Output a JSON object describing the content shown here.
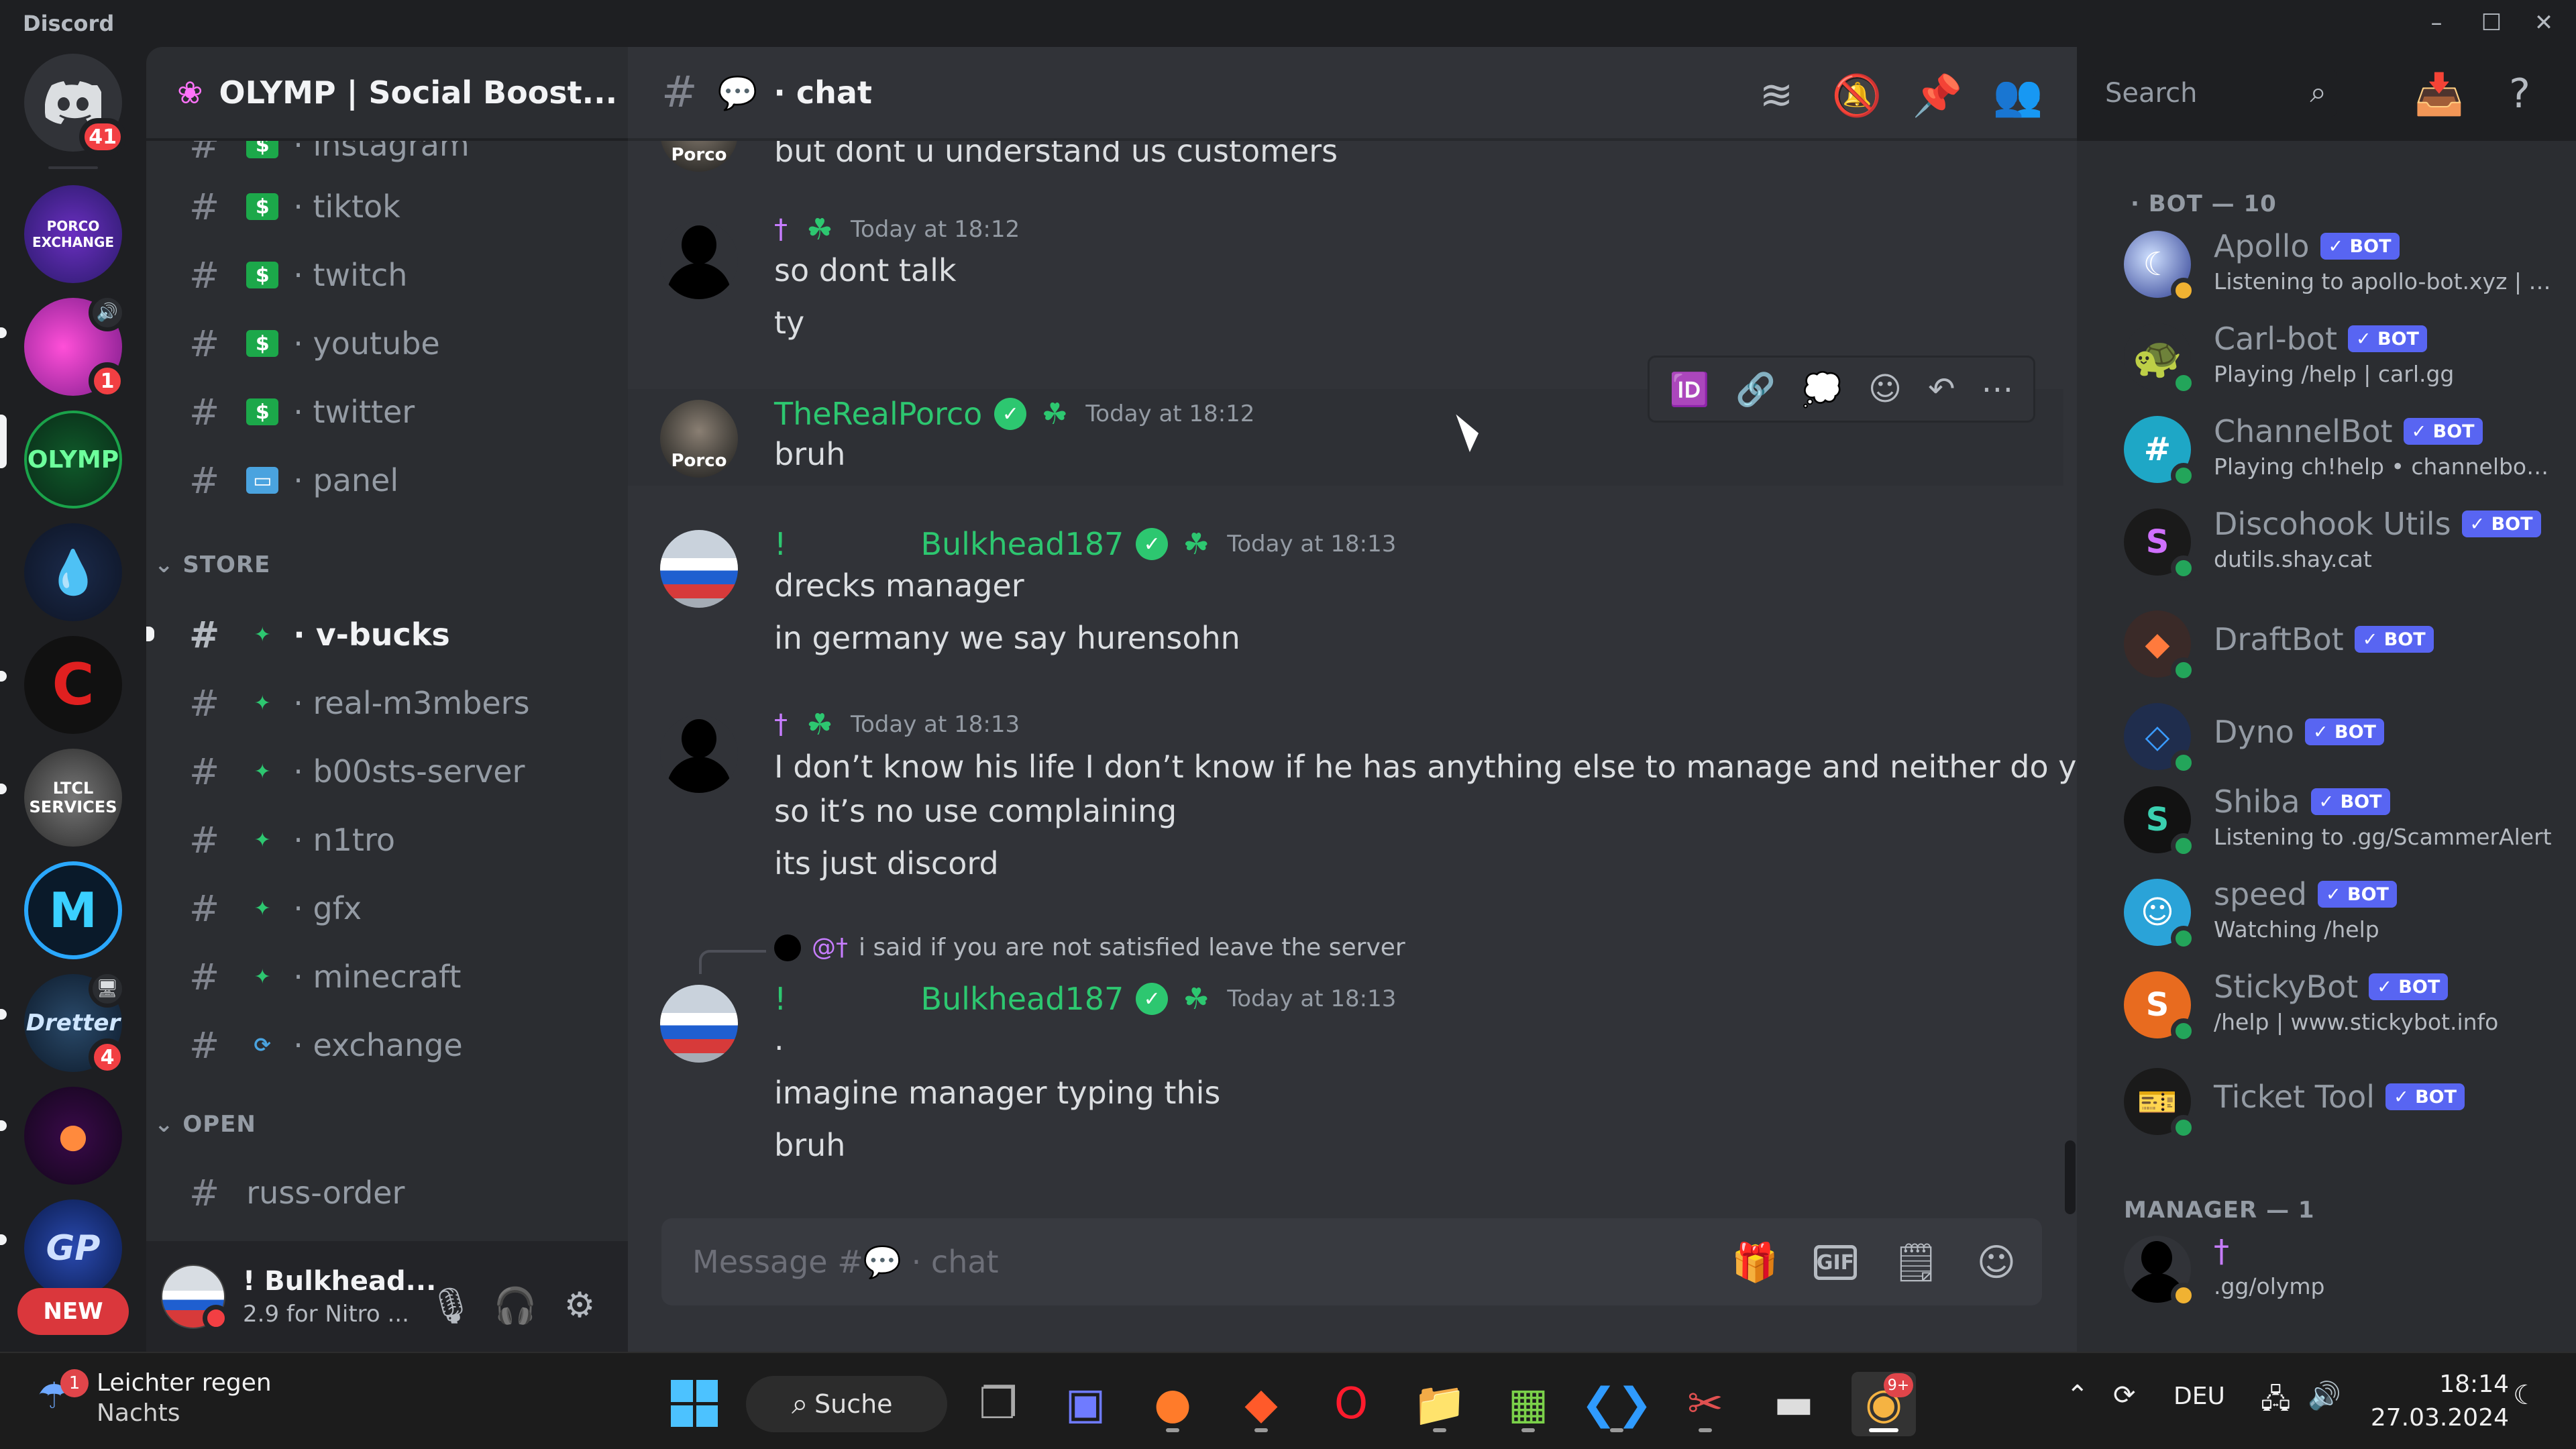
{
  "window": {
    "title": "Discord",
    "controls": [
      "–",
      "☐",
      "✕"
    ]
  },
  "rail": {
    "home_badge": "41",
    "server_badges": {
      "s2": "1",
      "s9": "4"
    },
    "server_labels": {
      "porco": "PORCO EXCHANGE",
      "olymp": "OLYMP",
      "ltcl": "LTCL SERVICES",
      "gp": "GP",
      "dretter": "Dretter"
    },
    "new_label": "NEW"
  },
  "guild": {
    "name": "OLYMP | Social Boost...",
    "channels_top": [
      {
        "name": "instagram",
        "emoji": "money"
      },
      {
        "name": "tiktok",
        "emoji": "money"
      },
      {
        "name": "twitch",
        "emoji": "money"
      },
      {
        "name": "youtube",
        "emoji": "money"
      },
      {
        "name": "twitter",
        "emoji": "money"
      },
      {
        "name": "panel",
        "emoji": "laptop"
      }
    ],
    "category_store": "STORE",
    "channels_store": [
      {
        "name": "v-bucks",
        "active": true
      },
      {
        "name": "real-m3mbers"
      },
      {
        "name": "b00sts-server"
      },
      {
        "name": "n1tro"
      },
      {
        "name": "gfx"
      },
      {
        "name": "minecraft"
      },
      {
        "name": "exchange"
      }
    ],
    "category_open": "OPEN",
    "channels_open": [
      {
        "name": "russ-order"
      }
    ]
  },
  "user": {
    "name": "! Bulkhead...",
    "status": "2.9 for Nitro ..."
  },
  "chat": {
    "channel_name": "chat",
    "search_placeholder": "Search",
    "messages": [
      {
        "type": "cont",
        "text": "but dont u understand us customers"
      },
      {
        "author_prefix": "†",
        "author": "",
        "time": "Today at 18:12",
        "lines": [
          "so dont talk",
          "ty"
        ]
      },
      {
        "author": "TheRealPorco",
        "time": "Today at 18:12",
        "lines": [
          "bruh"
        ]
      },
      {
        "author_prefix": "!",
        "author": "Bulkhead187",
        "time": "Today at 18:13",
        "lines": [
          "drecks manager",
          "in germany we say hurensohn"
        ]
      },
      {
        "author_prefix": "†",
        "author": "",
        "time": "Today at 18:13",
        "lines": [
          "I don’t know his life I don’t know if he has anything else to manage and neither do you",
          "so it’s no use complaining",
          "its just discord"
        ]
      },
      {
        "reply_mention": "@†",
        "reply_text": "i said if you are not satisfied leave the server",
        "author_prefix": "!",
        "author": "Bulkhead187",
        "time": "Today at 18:13",
        "lines": [
          ".",
          "imagine manager typing this",
          "bruh"
        ]
      }
    ],
    "composer_placeholder": "Message #💬 · chat"
  },
  "members": {
    "bot_header": "BOT — 10",
    "bots": [
      {
        "name": "Apollo",
        "status": "Listening to apollo-bot.xyz | A...",
        "color": "#2a3a8f",
        "presence": "idle"
      },
      {
        "name": "Carl-bot",
        "status": "Playing /help | carl.gg",
        "color": "#6b8e23",
        "presence": "online"
      },
      {
        "name": "ChannelBot",
        "status": "Playing ch!help • channelbot....",
        "color": "#1ea7c6",
        "presence": "online"
      },
      {
        "name": "Discohook Utils",
        "status": "dutils.shay.cat",
        "color": "#1a1a1a",
        "presence": "online"
      },
      {
        "name": "DraftBot",
        "status": "",
        "color": "#3a2a28",
        "presence": "online"
      },
      {
        "name": "Dyno",
        "status": "",
        "color": "#1f2d4d",
        "presence": "online"
      },
      {
        "name": "Shiba",
        "status": "Listening to .gg/ScammerAlert",
        "color": "#121212",
        "presence": "online"
      },
      {
        "name": "speed",
        "status": "Watching /help",
        "color": "#2aa3d8",
        "presence": "online"
      },
      {
        "name": "StickyBot",
        "status": "/help | www.stickybot.info",
        "color": "#e86b1f",
        "presence": "online"
      },
      {
        "name": "Ticket Tool",
        "status": "",
        "color": "#1a1a1a",
        "presence": "online"
      }
    ],
    "bot_tag": "BOT",
    "manager_header": "MANAGER — 1",
    "manager": {
      "name": "†",
      "status": ".gg/olymp"
    }
  },
  "taskbar": {
    "weather_badge": "1",
    "weather_line1": "Leichter regen",
    "weather_line2": "Nachts",
    "search_label": "Suche",
    "lang": "DEU",
    "time": "18:14",
    "date": "27.03.2024",
    "discord_badge": "9+"
  },
  "icons": {
    "threads": "threads-icon",
    "mute": "bell-slash-icon",
    "pin": "pin-icon",
    "members": "members-icon",
    "inbox": "inbox-icon",
    "help": "help-icon",
    "gift": "gift-icon",
    "gif": "gif-icon",
    "sticker": "sticker-icon",
    "emoji": "emoji-icon",
    "mic": "mic-icon",
    "headphones": "headphones-icon",
    "settings": "gear-icon"
  },
  "colors": {
    "accent": "#5865f2",
    "green_name": "#2dc770",
    "online": "#23a55a",
    "dnd": "#f23f43",
    "bg_chat": "#313338",
    "bg_sidebar": "#2b2d31"
  }
}
